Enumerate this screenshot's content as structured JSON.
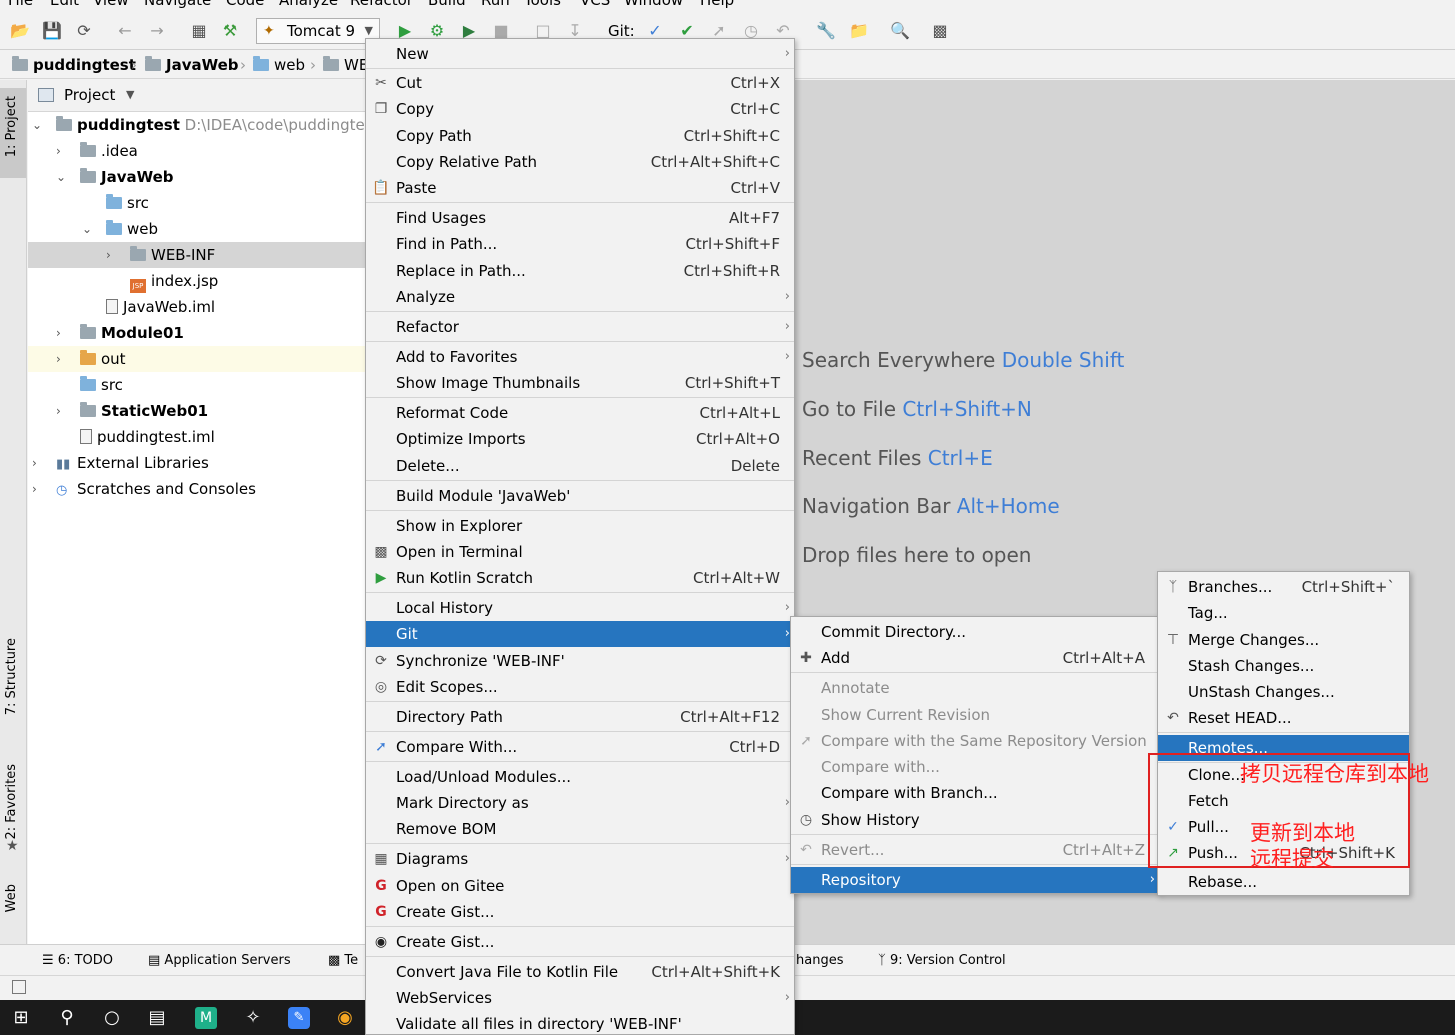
{
  "menubar": [
    "File",
    "Edit",
    "View",
    "Navigate",
    "Code",
    "Analyze",
    "Refactor",
    "Build",
    "Run",
    "Tools",
    "VCS",
    "Window",
    "Help"
  ],
  "toolbar": {
    "run_config": "Tomcat 9",
    "git_label": "Git:"
  },
  "breadcrumb": [
    "puddingtest",
    "JavaWeb",
    "web",
    "WE"
  ],
  "left_tabs": [
    "1: Project",
    "7: Structure",
    "2: Favorites",
    "Web"
  ],
  "project": {
    "header": "Project",
    "tree": [
      {
        "label": "puddingtest",
        "path": "D:\\IDEA\\code\\puddingtes"
      },
      {
        "label": ".idea"
      },
      {
        "label": "JavaWeb"
      },
      {
        "label": "src"
      },
      {
        "label": "web"
      },
      {
        "label": "WEB-INF"
      },
      {
        "label": "index.jsp"
      },
      {
        "label": "JavaWeb.iml"
      },
      {
        "label": "Module01"
      },
      {
        "label": "out"
      },
      {
        "label": "src"
      },
      {
        "label": "StaticWeb01"
      },
      {
        "label": "puddingtest.iml"
      },
      {
        "label": "External Libraries"
      },
      {
        "label": "Scratches and Consoles"
      }
    ]
  },
  "editor_hints": [
    {
      "text": "Search Everywhere",
      "shortcut": "Double Shift"
    },
    {
      "text": "Go to File",
      "shortcut": "Ctrl+Shift+N"
    },
    {
      "text": "Recent Files",
      "shortcut": "Ctrl+E"
    },
    {
      "text": "Navigation Bar",
      "shortcut": "Alt+Home"
    },
    {
      "text": "Drop files here to open",
      "shortcut": ""
    }
  ],
  "bottom_tabs": [
    "6: TODO",
    "Application Servers",
    "Te",
    "hanges",
    "9: Version Control"
  ],
  "context_menu": [
    {
      "label": "New",
      "shortcut": ""
    },
    {
      "label": "Cut",
      "shortcut": "Ctrl+X"
    },
    {
      "label": "Copy",
      "shortcut": "Ctrl+C"
    },
    {
      "label": "Copy Path",
      "shortcut": "Ctrl+Shift+C"
    },
    {
      "label": "Copy Relative Path",
      "shortcut": "Ctrl+Alt+Shift+C"
    },
    {
      "label": "Paste",
      "shortcut": "Ctrl+V"
    },
    {
      "label": "Find Usages",
      "shortcut": "Alt+F7"
    },
    {
      "label": "Find in Path...",
      "shortcut": "Ctrl+Shift+F"
    },
    {
      "label": "Replace in Path...",
      "shortcut": "Ctrl+Shift+R"
    },
    {
      "label": "Analyze",
      "shortcut": ""
    },
    {
      "label": "Refactor",
      "shortcut": ""
    },
    {
      "label": "Add to Favorites",
      "shortcut": ""
    },
    {
      "label": "Show Image Thumbnails",
      "shortcut": "Ctrl+Shift+T"
    },
    {
      "label": "Reformat Code",
      "shortcut": "Ctrl+Alt+L"
    },
    {
      "label": "Optimize Imports",
      "shortcut": "Ctrl+Alt+O"
    },
    {
      "label": "Delete...",
      "shortcut": "Delete"
    },
    {
      "label": "Build Module 'JavaWeb'",
      "shortcut": ""
    },
    {
      "label": "Show in Explorer",
      "shortcut": ""
    },
    {
      "label": "Open in Terminal",
      "shortcut": ""
    },
    {
      "label": "Run Kotlin Scratch",
      "shortcut": "Ctrl+Alt+W"
    },
    {
      "label": "Local History",
      "shortcut": ""
    },
    {
      "label": "Git",
      "shortcut": ""
    },
    {
      "label": "Synchronize 'WEB-INF'",
      "shortcut": ""
    },
    {
      "label": "Edit Scopes...",
      "shortcut": ""
    },
    {
      "label": "Directory Path",
      "shortcut": "Ctrl+Alt+F12"
    },
    {
      "label": "Compare With...",
      "shortcut": "Ctrl+D"
    },
    {
      "label": "Load/Unload Modules...",
      "shortcut": ""
    },
    {
      "label": "Mark Directory as",
      "shortcut": ""
    },
    {
      "label": "Remove BOM",
      "shortcut": ""
    },
    {
      "label": "Diagrams",
      "shortcut": ""
    },
    {
      "label": "Open on Gitee",
      "shortcut": ""
    },
    {
      "label": "Create Gist...",
      "shortcut": ""
    },
    {
      "label": "Create Gist...",
      "shortcut": ""
    },
    {
      "label": "Convert Java File to Kotlin File",
      "shortcut": "Ctrl+Alt+Shift+K"
    },
    {
      "label": "WebServices",
      "shortcut": ""
    },
    {
      "label": "Validate all files in directory 'WEB-INF'",
      "shortcut": ""
    }
  ],
  "git_menu": [
    {
      "label": "Commit Directory...",
      "shortcut": ""
    },
    {
      "label": "Add",
      "shortcut": "Ctrl+Alt+A"
    },
    {
      "label": "Annotate",
      "shortcut": ""
    },
    {
      "label": "Show Current Revision",
      "shortcut": ""
    },
    {
      "label": "Compare with the Same Repository Version",
      "shortcut": ""
    },
    {
      "label": "Compare with...",
      "shortcut": ""
    },
    {
      "label": "Compare with Branch...",
      "shortcut": ""
    },
    {
      "label": "Show History",
      "shortcut": ""
    },
    {
      "label": "Revert...",
      "shortcut": "Ctrl+Alt+Z"
    },
    {
      "label": "Repository",
      "shortcut": ""
    }
  ],
  "repo_menu": [
    {
      "label": "Branches...",
      "shortcut": "Ctrl+Shift+`"
    },
    {
      "label": "Tag...",
      "shortcut": ""
    },
    {
      "label": "Merge Changes...",
      "shortcut": ""
    },
    {
      "label": "Stash Changes...",
      "shortcut": ""
    },
    {
      "label": "UnStash Changes...",
      "shortcut": ""
    },
    {
      "label": "Reset HEAD...",
      "shortcut": ""
    },
    {
      "label": "Remotes...",
      "shortcut": ""
    },
    {
      "label": "Clone...",
      "shortcut": ""
    },
    {
      "label": "Fetch",
      "shortcut": ""
    },
    {
      "label": "Pull...",
      "shortcut": ""
    },
    {
      "label": "Push...",
      "shortcut": "Ctrl+Shift+K"
    },
    {
      "label": "Rebase...",
      "shortcut": ""
    }
  ],
  "annotations": {
    "clone_note": "拷贝远程仓库到本地",
    "pull_note": "更新到本地",
    "push_note": "远程提交"
  },
  "colors": {
    "selection": "#2675bf",
    "annotation": "#ff2020",
    "shortcut_hint": "#3e7ed6"
  }
}
